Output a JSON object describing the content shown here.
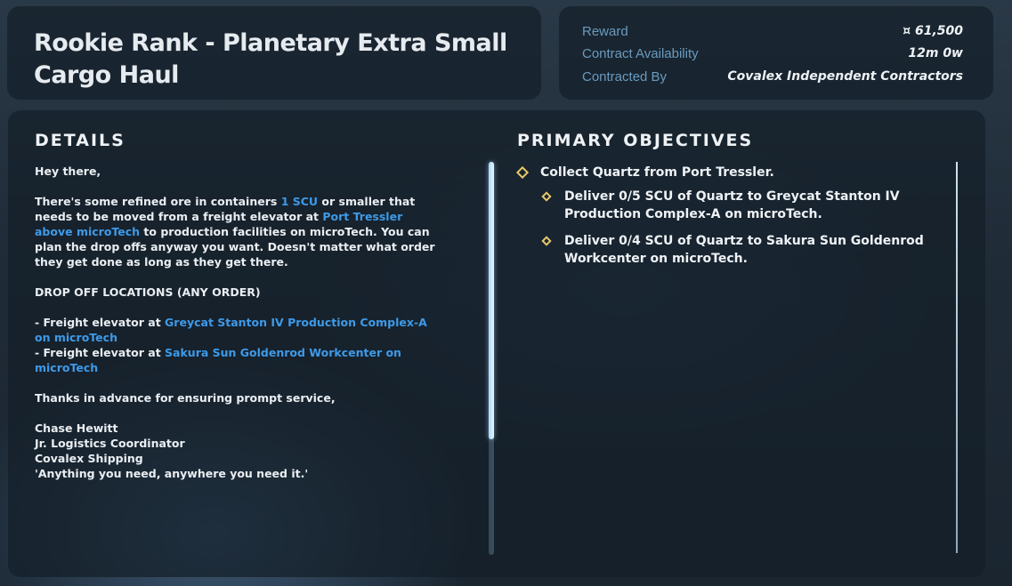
{
  "contract": {
    "title": "Rookie Rank - Planetary Extra Small Cargo Haul"
  },
  "info": {
    "reward_label": "Reward",
    "reward_value": "¤ 61,500",
    "availability_label": "Contract Availability",
    "availability_value": "12m 0w",
    "contracted_by_label": "Contracted By",
    "contracted_by_value": "Covalex Independent Contractors"
  },
  "details": {
    "heading": "DETAILS",
    "greeting": "Hey there,",
    "para1_a": "There's some refined ore in containers ",
    "para1_link1": "1 SCU",
    "para1_b": " or smaller that needs to be moved from a freight elevator at ",
    "para1_link2": "Port Tressler above microTech",
    "para1_c": " to production facilities on microTech. You can plan the drop offs anyway you want. Doesn't matter what order they get done as long as they get there.",
    "dropoff_heading": "DROP OFF LOCATIONS (ANY ORDER)",
    "drop1_prefix": "- Freight elevator at ",
    "drop1_link": "Greycat Stanton IV Production Complex-A on microTech",
    "drop2_prefix": "- Freight elevator at ",
    "drop2_link": "Sakura Sun Goldenrod Workcenter on microTech",
    "thanks": "Thanks in advance for ensuring prompt service,",
    "sig_name": "Chase Hewitt",
    "sig_title": "Jr. Logistics Coordinator",
    "sig_company": "Covalex Shipping",
    "sig_motto": "'Anything you need, anywhere you need it.'"
  },
  "objectives": {
    "heading": "PRIMARY OBJECTIVES",
    "main": "Collect Quartz from Port Tressler.",
    "sub": [
      "Deliver 0/5 SCU of Quartz to Greycat Stanton IV Production Complex-A on microTech.",
      "Deliver 0/4 SCU of Quartz to Sakura Sun Goldenrod Workcenter on microTech."
    ]
  },
  "colors": {
    "accent_link": "#3e9ae8",
    "label": "#6a9bbf",
    "objective_diamond": "#e8c86a"
  }
}
